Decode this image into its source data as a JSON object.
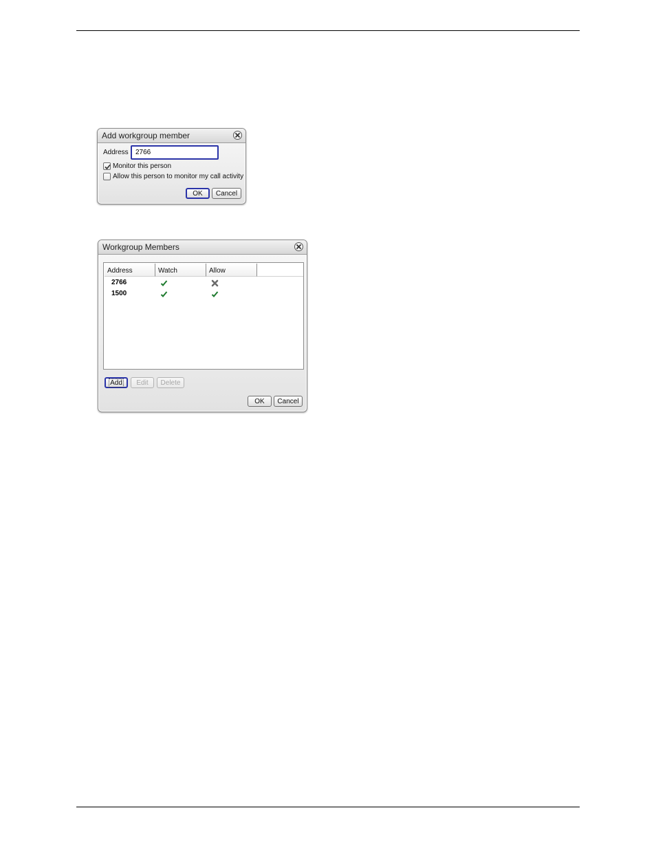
{
  "add_dialog": {
    "title": "Add workgroup member",
    "address_label": "Address",
    "address_value": "2766",
    "monitor_label": "Monitor this person",
    "monitor_checked": true,
    "allow_label": "Allow this person to monitor my call activity",
    "allow_checked": false,
    "ok_label": "OK",
    "cancel_label": "Cancel"
  },
  "members_dialog": {
    "title": "Workgroup Members",
    "columns": [
      "Address",
      "Watch",
      "Allow"
    ],
    "rows": [
      {
        "address": "2766",
        "watch": "check-icon",
        "allow": "cross-icon"
      },
      {
        "address": "1500",
        "watch": "check-icon",
        "allow": "check-icon"
      }
    ],
    "add_label": "Add",
    "edit_label": "Edit",
    "delete_label": "Delete",
    "ok_label": "OK",
    "cancel_label": "Cancel"
  },
  "colors": {
    "check": "#1e7a2e",
    "cross": "#6a6a6a",
    "focus_border": "#2b34a8"
  }
}
